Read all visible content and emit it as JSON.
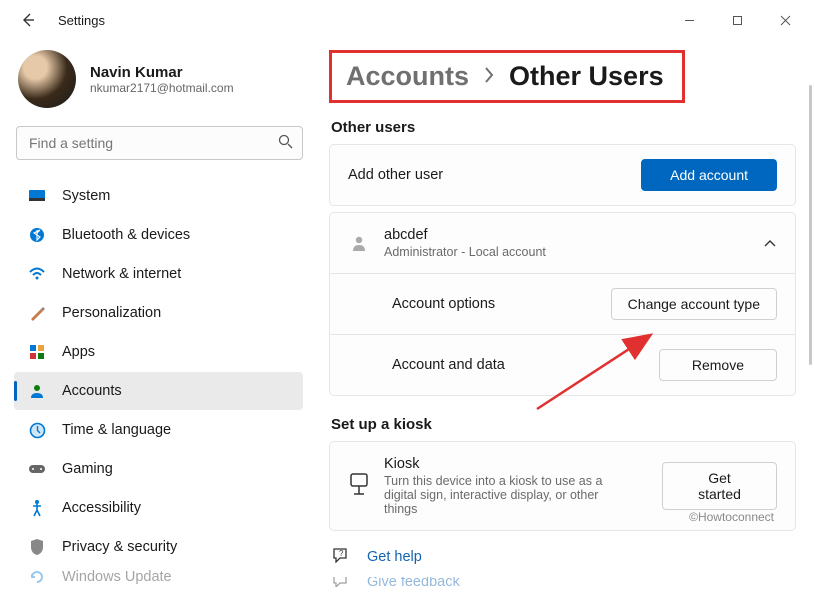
{
  "window": {
    "title": "Settings"
  },
  "profile": {
    "name": "Navin Kumar",
    "email": "nkumar2171@hotmail.com"
  },
  "search": {
    "placeholder": "Find a setting"
  },
  "sidebar": {
    "items": [
      {
        "label": "System",
        "icon": "system"
      },
      {
        "label": "Bluetooth & devices",
        "icon": "bluetooth"
      },
      {
        "label": "Network & internet",
        "icon": "wifi"
      },
      {
        "label": "Personalization",
        "icon": "brush"
      },
      {
        "label": "Apps",
        "icon": "apps"
      },
      {
        "label": "Accounts",
        "icon": "person"
      },
      {
        "label": "Time & language",
        "icon": "clock"
      },
      {
        "label": "Gaming",
        "icon": "gamepad"
      },
      {
        "label": "Accessibility",
        "icon": "accessibility"
      },
      {
        "label": "Privacy & security",
        "icon": "shield"
      },
      {
        "label": "Windows Update",
        "icon": "update"
      }
    ],
    "selected_index": 5
  },
  "breadcrumb": {
    "parent": "Accounts",
    "current": "Other Users"
  },
  "sections": {
    "other_users_header": "Other users",
    "add_other_user_label": "Add other user",
    "add_account_button": "Add account",
    "user": {
      "name": "abcdef",
      "role": "Administrator - Local account"
    },
    "account_options_label": "Account options",
    "change_type_button": "Change account type",
    "account_data_label": "Account and data",
    "remove_button": "Remove",
    "kiosk_header": "Set up a kiosk",
    "kiosk_title": "Kiosk",
    "kiosk_desc": "Turn this device into a kiosk to use as a digital sign, interactive display, or other things",
    "get_started_button": "Get started"
  },
  "help": {
    "get_help": "Get help",
    "give_feedback": "Give feedback"
  },
  "watermark": "©Howtoconnect"
}
